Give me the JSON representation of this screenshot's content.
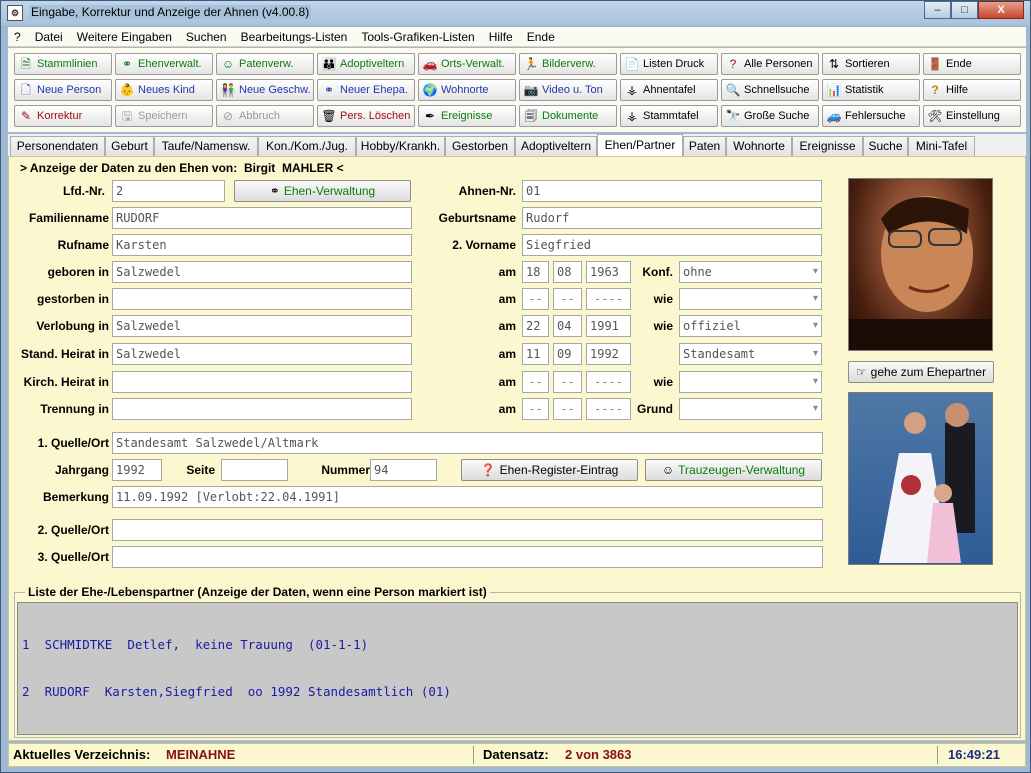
{
  "window": {
    "title": "Eingabe, Korrektur und Anzeige der Ahnen (v4.00.8)",
    "controls": {
      "minimize": "–",
      "maximize": "□",
      "close": "X"
    }
  },
  "menu": [
    "?",
    "Datei",
    "Weitere Eingaben",
    "Suchen",
    "Bearbeitungs-Listen",
    "Tools-Grafiken-Listen",
    "Hilfe",
    "Ende"
  ],
  "toolbar": {
    "stammlinien": "Stammlinien",
    "ehenverwalt": "Ehenverwalt.",
    "patenverw": "Patenverw.",
    "adoptiveltern": "Adoptiveltern",
    "orts_verwalt": "Orts-Verwalt.",
    "bilderverw": "Bilderverw.",
    "listen_druck": "Listen Druck",
    "alle_personen": "Alle Personen",
    "sortieren": "Sortieren",
    "ende": "Ende",
    "neue_person": "Neue Person",
    "neues_kind": "Neues Kind",
    "neue_geschw": "Neue Geschw.",
    "neuer_ehepa": "Neuer Ehepa.",
    "wohnorte": "Wohnorte",
    "video_ton": "Video u. Ton",
    "ahnentafel": "Ahnentafel",
    "schnellsuche": "Schnellsuche",
    "statistik": "Statistik",
    "hilfe": "Hilfe",
    "korrektur": "Korrektur",
    "speichern": "Speichern",
    "abbruch": "Abbruch",
    "pers_loeschen": "Pers.  Löschen",
    "ereignisse": "Ereignisse",
    "dokumente": "Dokumente",
    "stammtafel": "Stammtafel",
    "grosse_suche": "Große Suche",
    "fehlersuche": "Fehlersuche",
    "einstellung": "Einstellung"
  },
  "tabs": [
    "Personendaten",
    "Geburt",
    "Taufe/Namensw.",
    "Kon./Kom./Jug.",
    "Hobby/Krankh.",
    "Gestorben",
    "Adoptiveltern",
    "Ehen/Partner",
    "Paten",
    "Wohnorte",
    "Ereignisse",
    "Suche",
    "Mini-Tafel"
  ],
  "active_tab": "Ehen/Partner",
  "header": {
    "prefix": "> Anzeige der Daten zu den Ehen von:",
    "first_name": "Birgit",
    "last_name": "MAHLER <"
  },
  "labels": {
    "lfd_nr": "Lfd.-Nr.",
    "ahnen_nr": "Ahnen-Nr.",
    "familienname": "Familienname",
    "geburtsname": "Geburtsname",
    "rufname": "Rufname",
    "vorname2": "2. Vorname",
    "geboren_in": "geboren in",
    "gestorben_in": "gestorben in",
    "verlobung_in": "Verlobung in",
    "stand_heirat_in": "Stand. Heirat in",
    "kirch_heirat_in": "Kirch. Heirat in",
    "trennung_in": "Trennung in",
    "am": "am",
    "konf": "Konf.",
    "wie": "wie",
    "grund": "Grund",
    "quelle1": "1. Quelle/Ort",
    "jahrgang": "Jahrgang",
    "seite": "Seite",
    "nummer": "Nummer",
    "bemerkung": "Bemerkung",
    "quelle2": "2. Quelle/Ort",
    "quelle3": "3. Quelle/Ort"
  },
  "fields": {
    "lfd_nr": "2",
    "ahnen_nr": "01",
    "familienname": "RUDORF",
    "geburtsname": "Rudorf",
    "rufname": "Karsten",
    "vorname2": "Siegfried",
    "geboren_in": "Salzwedel",
    "geboren_day": "18",
    "geboren_month": "08",
    "geboren_year": "1963",
    "konf": "ohne",
    "gestorben_in": "",
    "gestorben_day": "--",
    "gestorben_month": "--",
    "gestorben_year": "----",
    "gestorben_wie": "",
    "verlobung_in": "Salzwedel",
    "verlobung_day": "22",
    "verlobung_month": "04",
    "verlobung_year": "1991",
    "verlobung_wie": "offiziel",
    "stand_heirat_in": "Salzwedel",
    "stand_day": "11",
    "stand_month": "09",
    "stand_year": "1992",
    "stand_wie": "Standesamt",
    "kirch_heirat_in": "",
    "kirch_day": "--",
    "kirch_month": "--",
    "kirch_year": "----",
    "kirch_wie": "",
    "trennung_in": "",
    "trennung_day": "--",
    "trennung_month": "--",
    "trennung_year": "----",
    "trennung_grund": "",
    "quelle1": "Standesamt Salzwedel/Altmark",
    "jahrgang": "1992",
    "seite": "",
    "nummer": "94",
    "bemerkung": "11.09.1992 [Verlobt:22.04.1991]",
    "quelle2": "",
    "quelle3": ""
  },
  "buttons": {
    "ehen_verwaltung": "Ehen-Verwaltung",
    "gehe_ehepartner": "gehe zum Ehepartner",
    "ehen_register": "Ehen-Register-Eintrag",
    "trauzeugen": "Trauzeugen-Verwaltung"
  },
  "partner_list": {
    "title": "Liste der Ehe-/Lebenspartner  (Anzeige der Daten, wenn eine Person markiert ist)",
    "rows": [
      "1  SCHMIDTKE  Detlef,  keine Trauung  (01-1-1)",
      "2  RUDORF  Karsten,Siegfried  oo 1992 Standesamtlich (01)"
    ]
  },
  "status": {
    "verzeichnis_label": "Aktuelles Verzeichnis:",
    "verzeichnis_value": "MEINAHNE",
    "datensatz_label": "Datensatz:",
    "datensatz_value": "2 von 3863",
    "time": "16:49:21"
  },
  "colors": {
    "accent_red": "#8b1010",
    "list_text": "#1a1aa5",
    "panel_bg": "#fbf8cf",
    "toolbar_green": "#0a7d0a",
    "toolbar_blue": "#1f3aa8"
  }
}
